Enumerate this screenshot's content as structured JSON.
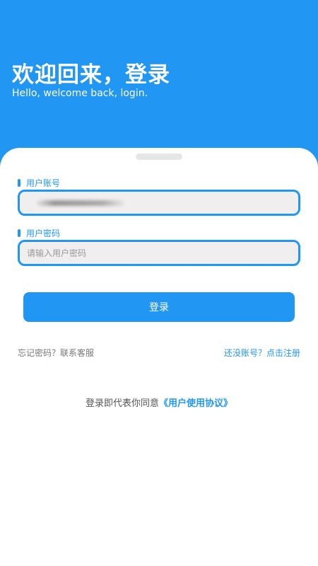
{
  "header": {
    "title": "欢迎回来，登录",
    "subtitle": "Hello, welcome back, login."
  },
  "form": {
    "account": {
      "label": "用户账号",
      "value": ""
    },
    "password": {
      "label": "用户密码",
      "placeholder": "请输入用户密码",
      "value": ""
    },
    "login_label": "登录"
  },
  "links": {
    "forgot": "忘记密码？联系客服",
    "register": "还没账号？点击注册"
  },
  "agreement": {
    "prefix": "登录即代表你同意",
    "link": "《用户使用协议》"
  },
  "colors": {
    "accent": "#2196f3",
    "input_bg": "#f0eeee",
    "sheet_bg": "#ffffff"
  }
}
